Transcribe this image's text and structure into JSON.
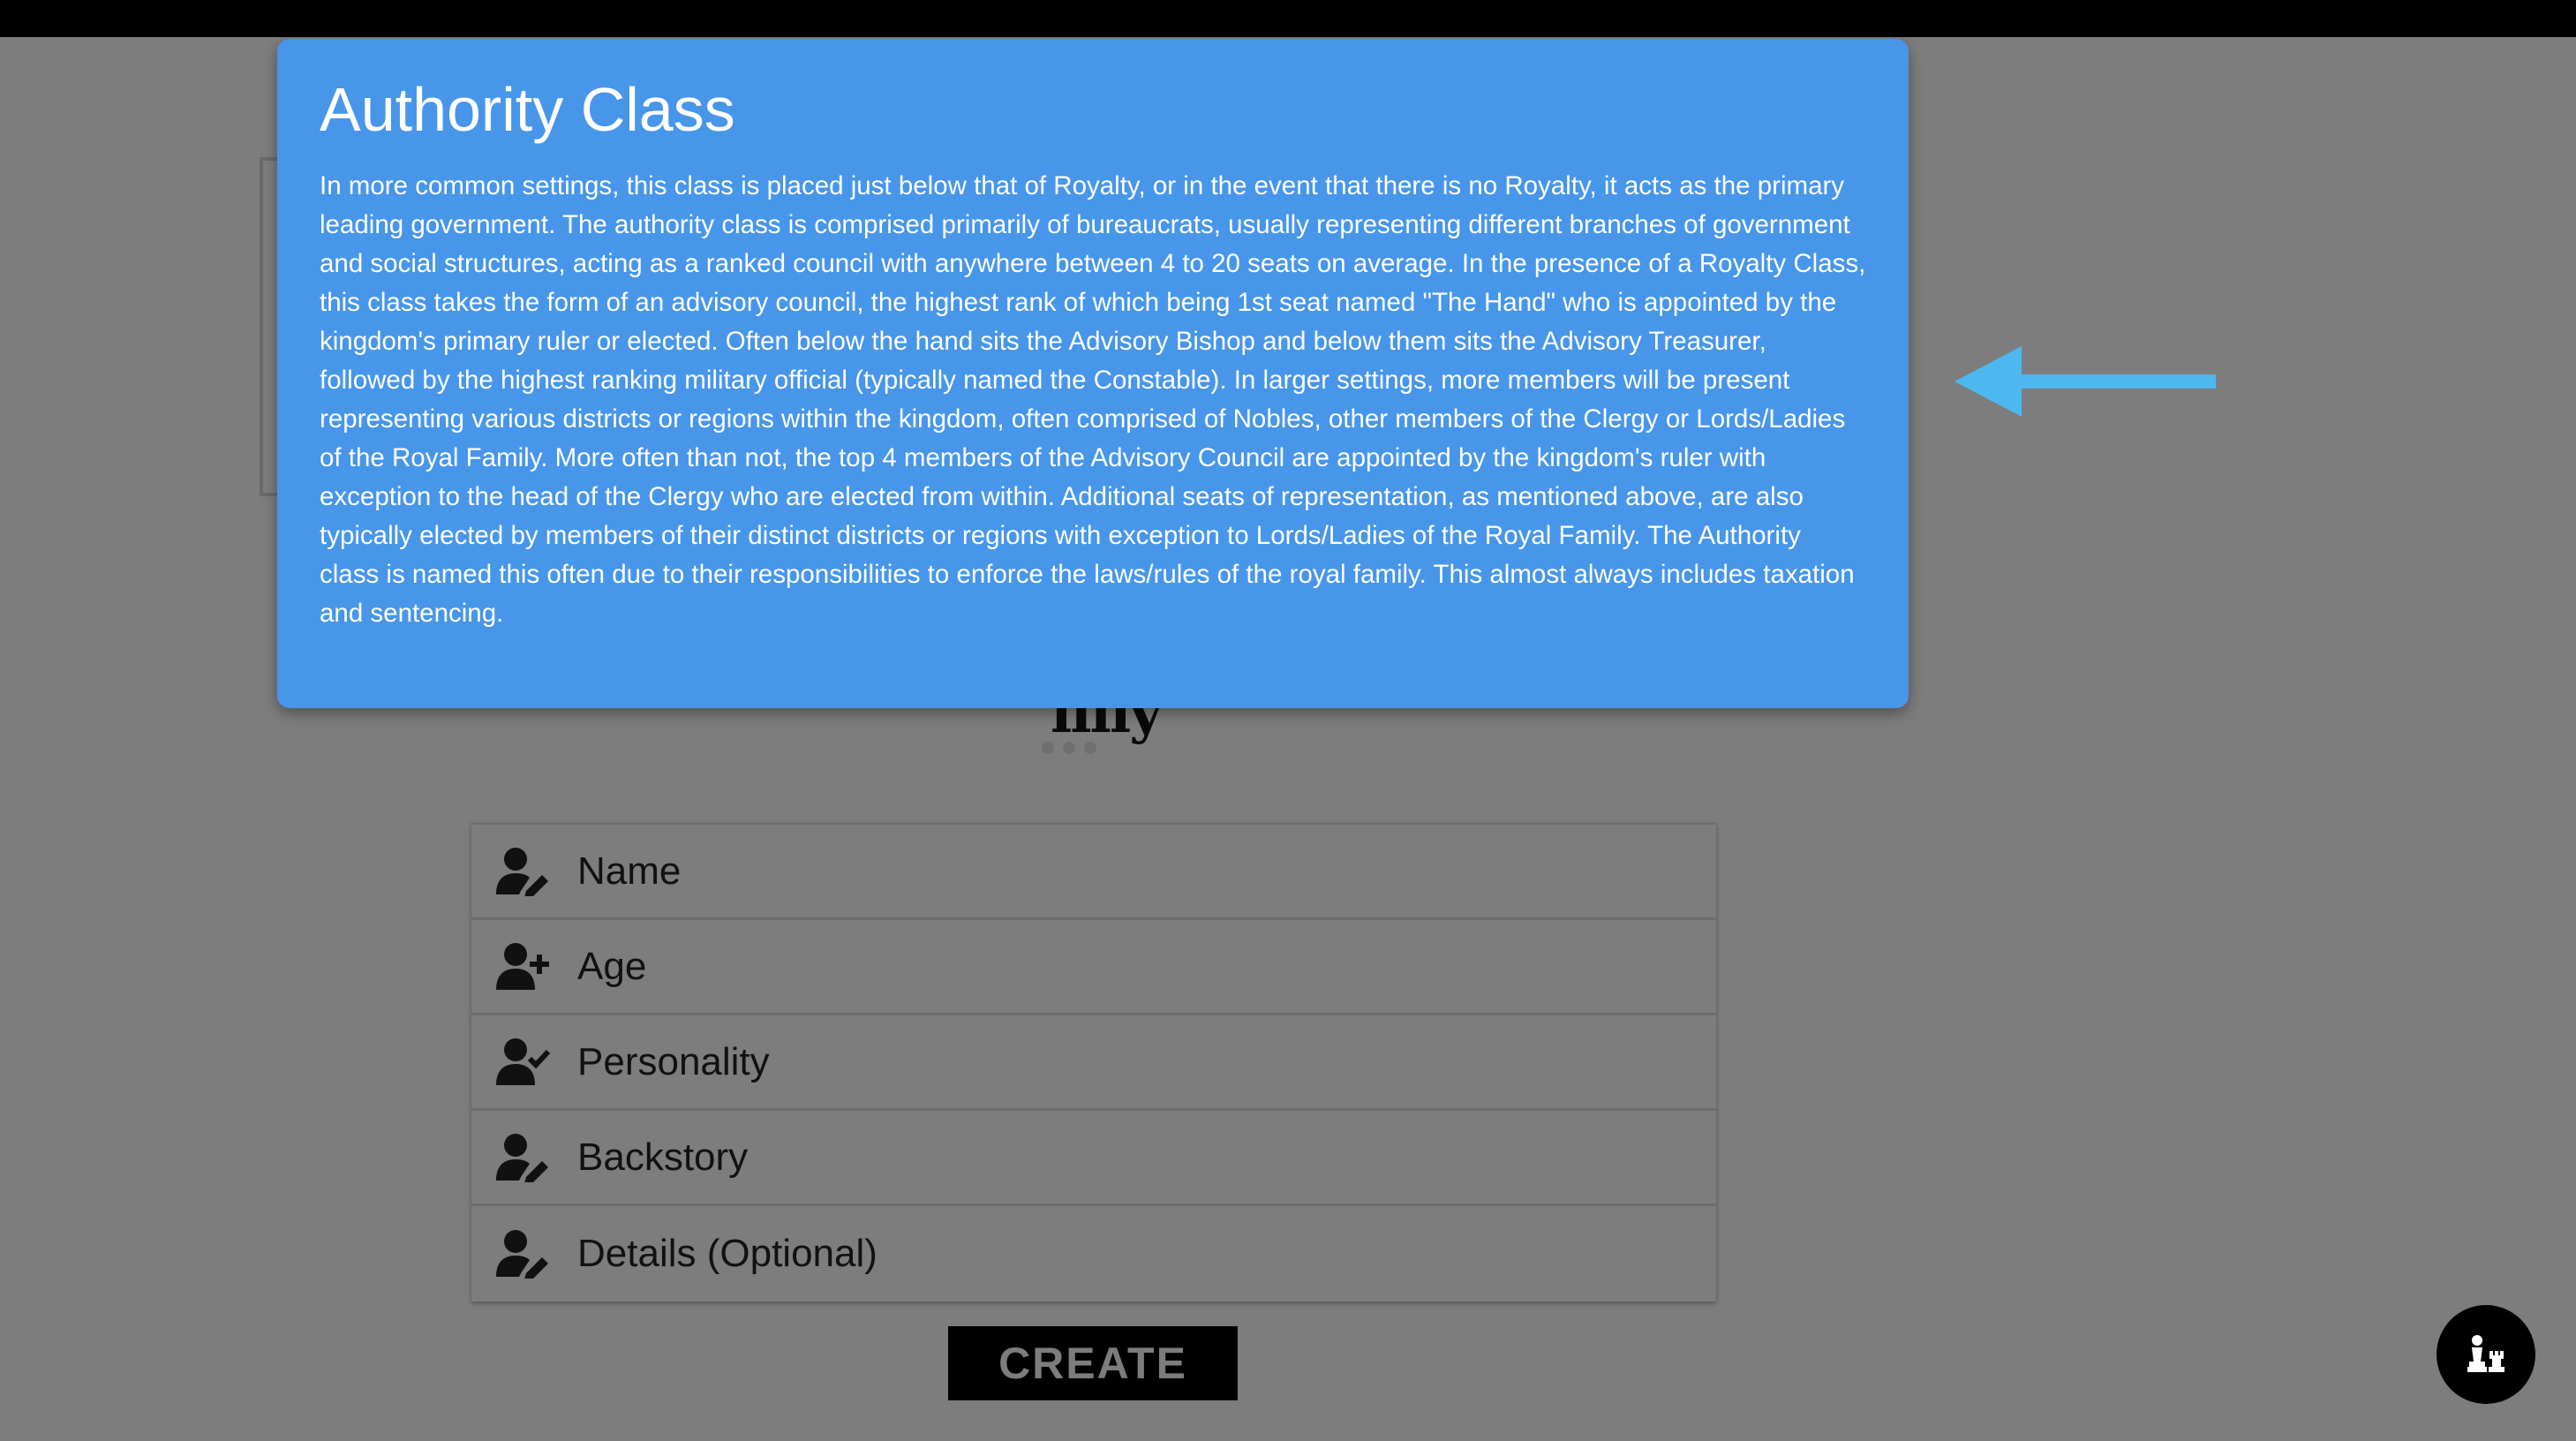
{
  "modal": {
    "title": "Authority Class",
    "body": "In more common settings, this class is placed just below that of Royalty, or in the event that there is no Royalty, it acts as the primary leading government. The authority class is comprised primarily of bureaucrats, usually representing different branches of government and social structures, acting as a ranked council with anywhere between 4 to 20 seats on average. In the presence of a Royalty Class, this class takes the form of an advisory council, the highest rank of which being 1st seat named \"The Hand\" who is appointed by the kingdom's primary ruler or elected. Often below the hand sits the Advisory Bishop and below them sits the Advisory Treasurer, followed by the highest ranking military official (typically named the Constable). In larger settings, more members will be present representing various districts or regions within the kingdom, often comprised of Nobles, other members of the Clergy or Lords/Ladies of the Royal Family. More often than not, the top 4 members of the Advisory Council are appointed by the kingdom's ruler with exception to the head of the Clergy who are elected from within. Additional seats of representation, as mentioned above, are also typically elected by members of their distinct districts or regions with exception to Lords/Ladies of the Royal Family. The Authority class is named this often due to their responsibilities to enforce the laws/rules of the royal family. This almost always includes taxation and sentencing.",
    "background_color": "#4796ea"
  },
  "background": {
    "title_fragment": "iiiiy"
  },
  "fields": [
    {
      "label": "Name",
      "icon": "user-edit-icon"
    },
    {
      "label": "Age",
      "icon": "user-plus-icon"
    },
    {
      "label": "Personality",
      "icon": "user-check-icon"
    },
    {
      "label": "Backstory",
      "icon": "user-edit-icon"
    },
    {
      "label": "Details (Optional)",
      "icon": "user-edit-icon"
    }
  ],
  "create_button": {
    "label": "CREATE"
  },
  "fab": {
    "icon": "chess-icon"
  },
  "colors": {
    "page_background": "#7d7d7d",
    "arrow": "#4db8f0",
    "button_background": "#000000"
  }
}
